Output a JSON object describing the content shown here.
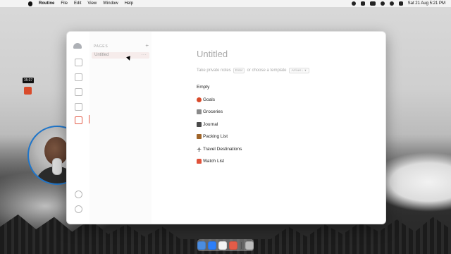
{
  "menubar": {
    "app_name": "Routine",
    "menus": [
      "File",
      "Edit",
      "View",
      "Window",
      "Help"
    ],
    "datetime": "Sat 21 Aug  5:21 PM",
    "status_icons": [
      "recording-icon",
      "wifi-icon",
      "battery-icon",
      "search-icon",
      "control-center-icon",
      "siri-icon",
      "display-icon"
    ]
  },
  "recording": {
    "time": "15:37",
    "stop_icon": "stop-icon",
    "accent": "#d94b2b"
  },
  "window": {
    "rail_icons": [
      "cloud-icon",
      "calendar-icon",
      "inbox-icon",
      "list-icon",
      "square-icon",
      "page-icon",
      "settings-icon",
      "help-icon"
    ],
    "active_rail_icon": "page-icon",
    "pages_panel": {
      "title": "PAGES",
      "add_label": "+",
      "items": [
        {
          "label": "Untitled",
          "more": "···"
        }
      ]
    },
    "editor": {
      "title": "Untitled",
      "hint_prefix": "Take private notes",
      "hint_key": "Enter",
      "hint_suffix": "or choose a template",
      "template_select": "Arrives ↓ ▾",
      "templates": [
        {
          "icon": "empty",
          "label": "Empty"
        },
        {
          "icon": "target-icon",
          "label": "Goals"
        },
        {
          "icon": "cart-icon",
          "label": "Groceries"
        },
        {
          "icon": "notebook-icon",
          "label": "Journal"
        },
        {
          "icon": "package-icon",
          "label": "Packing List"
        },
        {
          "icon": "airplane-icon",
          "label": "Travel Destinations"
        },
        {
          "icon": "popcorn-icon",
          "label": "Watch List"
        }
      ]
    },
    "accent": "#e45c48"
  },
  "dock": {
    "icons": [
      "finder-icon",
      "safari-icon",
      "calendar-icon",
      "routine-icon",
      "trash-icon"
    ]
  }
}
